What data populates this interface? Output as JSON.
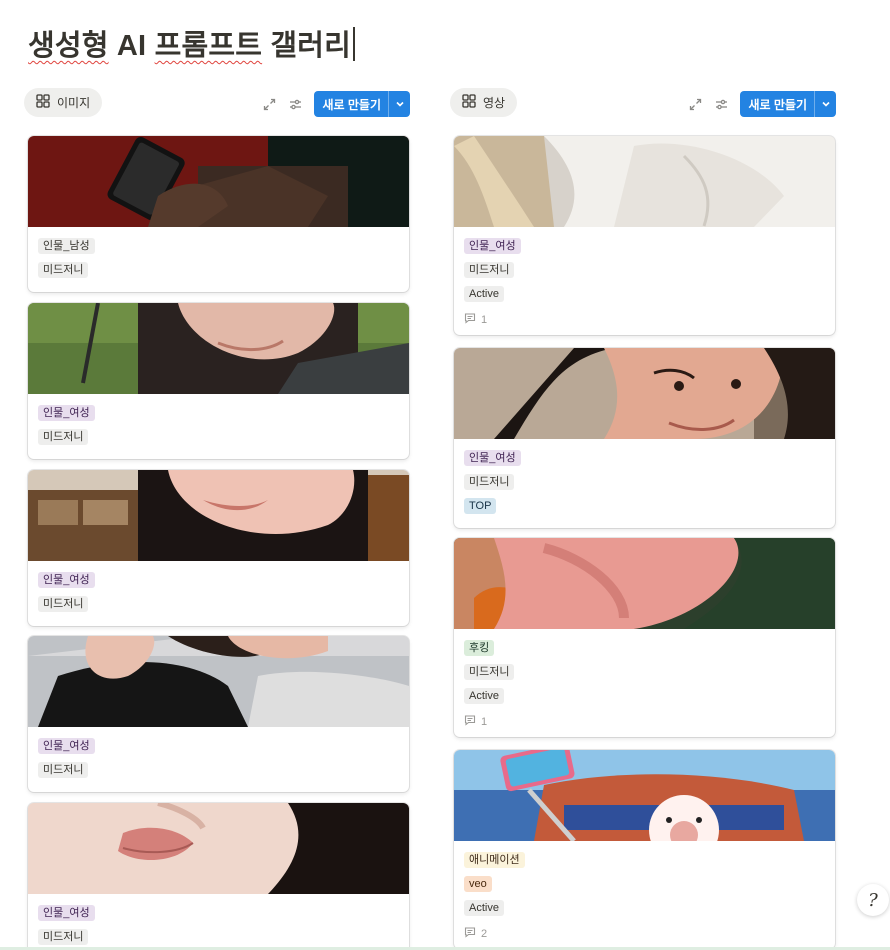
{
  "page": {
    "title_part1": "생성형",
    "title_part2": "AI",
    "title_part3": "프롬프트",
    "title_part4": "갤러리"
  },
  "views": [
    {
      "tab_label": "이미지",
      "tab_icon": "gallery-grid-icon",
      "new_label": "새로 만들기",
      "cards": [
        {
          "tags": [
            {
              "text": "인물_남성",
              "color": "gray"
            },
            {
              "text": "미드저니",
              "color": "gray"
            }
          ],
          "thumb": "hands-holding-phone"
        },
        {
          "tags": [
            {
              "text": "인물_여성",
              "color": "purple"
            },
            {
              "text": "미드저니",
              "color": "gray"
            }
          ],
          "thumb": "woman-smile-outdoor"
        },
        {
          "tags": [
            {
              "text": "인물_여성",
              "color": "purple"
            },
            {
              "text": "미드저니",
              "color": "gray"
            }
          ],
          "thumb": "woman-smile-room"
        },
        {
          "tags": [
            {
              "text": "인물_여성",
              "color": "purple"
            },
            {
              "text": "미드저니",
              "color": "gray"
            }
          ],
          "thumb": "two-women-selfie"
        },
        {
          "tags": [
            {
              "text": "인물_여성",
              "color": "purple"
            },
            {
              "text": "미드저니",
              "color": "gray"
            }
          ],
          "thumb": "woman-lips-closeup"
        }
      ]
    },
    {
      "tab_label": "영상",
      "tab_icon": "gallery-grid-icon",
      "new_label": "새로 만들기",
      "cards": [
        {
          "tags": [
            {
              "text": "인물_여성",
              "color": "purple"
            },
            {
              "text": "미드저니",
              "color": "gray"
            },
            {
              "text": "Active",
              "color": "gray"
            }
          ],
          "comments": "1",
          "thumb": "blonde-white-sweater"
        },
        {
          "tags": [
            {
              "text": "인물_여성",
              "color": "purple"
            },
            {
              "text": "미드저니",
              "color": "gray"
            },
            {
              "text": "TOP",
              "color": "blue"
            }
          ],
          "thumb": "woman-smiling-portrait"
        },
        {
          "tags": [
            {
              "text": "후킹",
              "color": "green"
            },
            {
              "text": "미드저니",
              "color": "gray"
            },
            {
              "text": "Active",
              "color": "gray"
            }
          ],
          "comments": "1",
          "thumb": "pink-hand-blur"
        },
        {
          "tags": [
            {
              "text": "애니메이션",
              "color": "yellow"
            },
            {
              "text": "veo",
              "color": "orange"
            },
            {
              "text": "Active",
              "color": "gray"
            }
          ],
          "comments": "2",
          "thumb": "animated-selfie-stick"
        }
      ]
    }
  ],
  "colors": {
    "accent": "#2383e2",
    "title": "#37352f"
  },
  "help_button_glyph": "?"
}
